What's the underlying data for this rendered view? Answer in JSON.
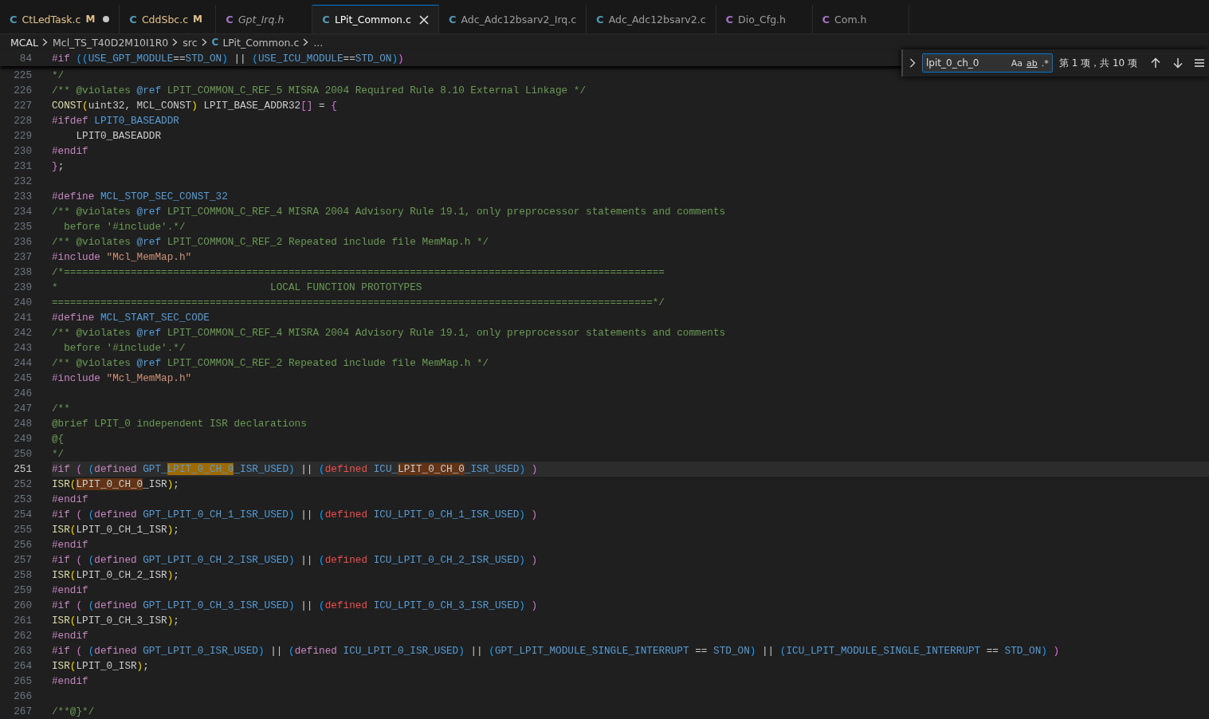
{
  "tabs": [
    {
      "icon": "C",
      "kind": "c",
      "label": "CtLedTask.c",
      "badge": "M",
      "unsaved": true,
      "preview": false,
      "selected": false
    },
    {
      "icon": "C",
      "kind": "c",
      "label": "CddSbc.c",
      "badge": "M",
      "unsaved": false,
      "preview": false,
      "selected": false
    },
    {
      "icon": "C",
      "kind": "h",
      "label": "Gpt_Irq.h",
      "unsaved": false,
      "preview": true,
      "selected": false
    },
    {
      "icon": "C",
      "kind": "c",
      "label": "LPit_Common.c",
      "unsaved": false,
      "preview": false,
      "selected": true
    },
    {
      "icon": "C",
      "kind": "c",
      "label": "Adc_Adc12bsarv2_Irq.c",
      "unsaved": false,
      "preview": false,
      "selected": false
    },
    {
      "icon": "C",
      "kind": "c",
      "label": "Adc_Adc12bsarv2.c",
      "unsaved": false,
      "preview": false,
      "selected": false
    },
    {
      "icon": "C",
      "kind": "h",
      "label": "Dio_Cfg.h",
      "unsaved": false,
      "preview": false,
      "selected": false
    },
    {
      "icon": "C",
      "kind": "h",
      "label": "Com.h",
      "unsaved": false,
      "preview": false,
      "selected": false
    }
  ],
  "breadcrumb": {
    "items": [
      "MCAL",
      "Mcl_TS_T40D2M10I1R0",
      "src"
    ],
    "file_icon": "C",
    "file": "LPit_Common.c",
    "more": "..."
  },
  "sticky_line": {
    "number": "84",
    "tokens": [
      {
        "text": "#if ",
        "kind": "kw"
      },
      {
        "text": "((",
        "kind": "b3"
      },
      {
        "text": "USE_GPT_MODULE",
        "kind": "id"
      },
      {
        "text": "==",
        "kind": "p"
      },
      {
        "text": "STD_ON",
        "kind": "id"
      },
      {
        "text": ")",
        "kind": "b3"
      },
      {
        "text": " || ",
        "kind": "p"
      },
      {
        "text": "(",
        "kind": "b3"
      },
      {
        "text": "USE_ICU_MODULE",
        "kind": "id"
      },
      {
        "text": "==",
        "kind": "p"
      },
      {
        "text": "STD_ON",
        "kind": "id"
      },
      {
        "text": ")",
        "kind": "b3"
      },
      {
        "text": ")",
        "kind": "b2"
      }
    ]
  },
  "find": {
    "value": "lpit_0_ch_0",
    "options": [
      "Aa",
      "ab",
      ".*"
    ],
    "result": "第 1 项，共 10 项"
  },
  "lines": [
    {
      "number": "225",
      "current": false,
      "tokens": [
        {
          "text": "*/",
          "kind": "cm"
        }
      ]
    },
    {
      "number": "226",
      "current": false,
      "tokens": [
        {
          "text": "/** @violates ",
          "kind": "cm"
        },
        {
          "text": "@ref",
          "kind": "ref"
        },
        {
          "text": " LPIT_COMMON_C_REF_5 MISRA 2004 Required Rule 8.10 External Linkage */",
          "kind": "cm"
        }
      ]
    },
    {
      "number": "227",
      "current": false,
      "tokens": [
        {
          "text": "CONST",
          "kind": "fn"
        },
        {
          "text": "(",
          "kind": "b1"
        },
        {
          "text": "uint32, MCL_CONST",
          "kind": "p"
        },
        {
          "text": ")",
          "kind": "b1"
        },
        {
          "text": " LPIT_BASE_ADDR32",
          "kind": "p"
        },
        {
          "text": "[]",
          "kind": "b2"
        },
        {
          "text": " = ",
          "kind": "p"
        },
        {
          "text": "{",
          "kind": "b2"
        }
      ]
    },
    {
      "number": "228",
      "current": false,
      "tokens": [
        {
          "text": "#ifdef ",
          "kind": "kw"
        },
        {
          "text": "LPIT0_BASEADDR",
          "kind": "id"
        }
      ]
    },
    {
      "number": "229",
      "current": false,
      "tokens": [
        {
          "text": "    LPIT0_BASEADDR",
          "kind": "p"
        }
      ]
    },
    {
      "number": "230",
      "current": false,
      "tokens": [
        {
          "text": "#endif",
          "kind": "kw"
        }
      ]
    },
    {
      "number": "231",
      "current": false,
      "tokens": [
        {
          "text": "}",
          "kind": "b2"
        },
        {
          "text": ";",
          "kind": "p"
        }
      ]
    },
    {
      "number": "232",
      "current": false
    },
    {
      "number": "233",
      "current": false,
      "tokens": [
        {
          "text": "#define ",
          "kind": "kw"
        },
        {
          "text": "MCL_STOP_SEC_CONST_32",
          "kind": "id"
        }
      ]
    },
    {
      "number": "234",
      "current": false,
      "tokens": [
        {
          "text": "/** @violates ",
          "kind": "cm"
        },
        {
          "text": "@ref",
          "kind": "ref"
        },
        {
          "text": " LPIT_COMMON_C_REF_4 MISRA 2004 Advisory Rule 19.1, only preprocessor statements and comments",
          "kind": "cm"
        }
      ]
    },
    {
      "number": "235",
      "current": false,
      "tokens": [
        {
          "text": "  before '#include'.*/",
          "kind": "cm"
        }
      ]
    },
    {
      "number": "236",
      "current": false,
      "tokens": [
        {
          "text": "/** @violates ",
          "kind": "cm"
        },
        {
          "text": "@ref",
          "kind": "ref"
        },
        {
          "text": " LPIT_COMMON_C_REF_2 Repeated include file MemMap.h */",
          "kind": "cm"
        }
      ]
    },
    {
      "number": "237",
      "current": false,
      "tokens": [
        {
          "text": "#include ",
          "kind": "kw"
        },
        {
          "text": "\"Mcl_MemMap.h\"",
          "kind": "str"
        }
      ]
    },
    {
      "number": "238",
      "current": false,
      "tokens": [
        {
          "text": "/*===================================================================================================",
          "kind": "cm"
        }
      ]
    },
    {
      "number": "239",
      "current": false,
      "tokens": [
        {
          "text": "*                                   LOCAL FUNCTION PROTOTYPES",
          "kind": "cm"
        }
      ]
    },
    {
      "number": "240",
      "current": false,
      "tokens": [
        {
          "text": "===================================================================================================*/",
          "kind": "cm"
        }
      ]
    },
    {
      "number": "241",
      "current": false,
      "tokens": [
        {
          "text": "#define ",
          "kind": "kw"
        },
        {
          "text": "MCL_START_SEC_CODE",
          "kind": "id"
        }
      ]
    },
    {
      "number": "242",
      "current": false,
      "tokens": [
        {
          "text": "/** @violates ",
          "kind": "cm"
        },
        {
          "text": "@ref",
          "kind": "ref"
        },
        {
          "text": " LPIT_COMMON_C_REF_4 MISRA 2004 Advisory Rule 19.1, only preprocessor statements and comments",
          "kind": "cm"
        }
      ]
    },
    {
      "number": "243",
      "current": false,
      "tokens": [
        {
          "text": "  before '#include'.*/",
          "kind": "cm"
        }
      ]
    },
    {
      "number": "244",
      "current": false,
      "tokens": [
        {
          "text": "/** @violates ",
          "kind": "cm"
        },
        {
          "text": "@ref",
          "kind": "ref"
        },
        {
          "text": " LPIT_COMMON_C_REF_2 Repeated include file MemMap.h */",
          "kind": "cm"
        }
      ]
    },
    {
      "number": "245",
      "current": false,
      "tokens": [
        {
          "text": "#include ",
          "kind": "kw"
        },
        {
          "text": "\"Mcl_MemMap.h\"",
          "kind": "str"
        }
      ]
    },
    {
      "number": "246",
      "current": false
    },
    {
      "number": "247",
      "current": false,
      "tokens": [
        {
          "text": "/**",
          "kind": "cm"
        }
      ]
    },
    {
      "number": "248",
      "current": false,
      "tokens": [
        {
          "text": "@brief LPIT_0 independent ISR declarations",
          "kind": "cm"
        }
      ]
    },
    {
      "number": "249",
      "current": false,
      "tokens": [
        {
          "text": "@{",
          "kind": "cm"
        }
      ]
    },
    {
      "number": "250",
      "current": false,
      "tokens": [
        {
          "text": "*/",
          "kind": "cm"
        }
      ]
    },
    {
      "number": "251",
      "current": true,
      "tokens": [
        {
          "text": "#if ",
          "kind": "kw"
        },
        {
          "text": "( ",
          "kind": "b2"
        },
        {
          "text": "(",
          "kind": "b3"
        },
        {
          "text": "defined ",
          "kind": "kw"
        },
        {
          "text": "GPT_",
          "kind": "id"
        },
        {
          "text": "LPIT_0_CH_0",
          "kind": "hl"
        },
        {
          "text": "_ISR_USED",
          "kind": "id"
        },
        {
          "text": ")",
          "kind": "b3"
        },
        {
          "text": " || ",
          "kind": "p"
        },
        {
          "text": "(",
          "kind": "b3"
        },
        {
          "text": "defined ",
          "kind": "err"
        },
        {
          "text": "ICU_",
          "kind": "id"
        },
        {
          "text": "LPIT_0_CH_0",
          "kind": "hl2"
        },
        {
          "text": "_ISR_USED",
          "kind": "id"
        },
        {
          "text": ")",
          "kind": "b3"
        },
        {
          "text": " )",
          "kind": "b2"
        }
      ]
    },
    {
      "number": "252",
      "current": false,
      "tokens": [
        {
          "text": "ISR",
          "kind": "fn"
        },
        {
          "text": "(",
          "kind": "b1"
        },
        {
          "text": "LPIT_0_CH_0",
          "kind": "hl2"
        },
        {
          "text": "_ISR",
          "kind": "p"
        },
        {
          "text": ")",
          "kind": "b1"
        },
        {
          "text": ";",
          "kind": "p"
        }
      ]
    },
    {
      "number": "253",
      "current": false,
      "tokens": [
        {
          "text": "#endif",
          "kind": "kw"
        }
      ]
    },
    {
      "number": "254",
      "current": false,
      "tokens": [
        {
          "text": "#if ",
          "kind": "kw"
        },
        {
          "text": "( ",
          "kind": "b2"
        },
        {
          "text": "(",
          "kind": "b3"
        },
        {
          "text": "defined ",
          "kind": "kw"
        },
        {
          "text": "GPT_LPIT_0_CH_1_ISR_USED",
          "kind": "id"
        },
        {
          "text": ")",
          "kind": "b3"
        },
        {
          "text": " || ",
          "kind": "p"
        },
        {
          "text": "(",
          "kind": "b3"
        },
        {
          "text": "defined ",
          "kind": "err"
        },
        {
          "text": "ICU_LPIT_0_CH_1_ISR_USED",
          "kind": "id"
        },
        {
          "text": ")",
          "kind": "b3"
        },
        {
          "text": " )",
          "kind": "b2"
        }
      ]
    },
    {
      "number": "255",
      "current": false,
      "tokens": [
        {
          "text": "ISR",
          "kind": "fn"
        },
        {
          "text": "(",
          "kind": "b1"
        },
        {
          "text": "LPIT_0_CH_1_ISR",
          "kind": "p"
        },
        {
          "text": ")",
          "kind": "b1"
        },
        {
          "text": ";",
          "kind": "p"
        }
      ]
    },
    {
      "number": "256",
      "current": false,
      "tokens": [
        {
          "text": "#endif",
          "kind": "kw"
        }
      ]
    },
    {
      "number": "257",
      "current": false,
      "tokens": [
        {
          "text": "#if ",
          "kind": "kw"
        },
        {
          "text": "( ",
          "kind": "b2"
        },
        {
          "text": "(",
          "kind": "b3"
        },
        {
          "text": "defined ",
          "kind": "kw"
        },
        {
          "text": "GPT_LPIT_0_CH_2_ISR_USED",
          "kind": "id"
        },
        {
          "text": ")",
          "kind": "b3"
        },
        {
          "text": " || ",
          "kind": "p"
        },
        {
          "text": "(",
          "kind": "b3"
        },
        {
          "text": "defined ",
          "kind": "err"
        },
        {
          "text": "ICU_LPIT_0_CH_2_ISR_USED",
          "kind": "id"
        },
        {
          "text": ")",
          "kind": "b3"
        },
        {
          "text": " )",
          "kind": "b2"
        }
      ]
    },
    {
      "number": "258",
      "current": false,
      "tokens": [
        {
          "text": "ISR",
          "kind": "fn"
        },
        {
          "text": "(",
          "kind": "b1"
        },
        {
          "text": "LPIT_0_CH_2_ISR",
          "kind": "p"
        },
        {
          "text": ")",
          "kind": "b1"
        },
        {
          "text": ";",
          "kind": "p"
        }
      ]
    },
    {
      "number": "259",
      "current": false,
      "tokens": [
        {
          "text": "#endif",
          "kind": "kw"
        }
      ]
    },
    {
      "number": "260",
      "current": false,
      "tokens": [
        {
          "text": "#if ",
          "kind": "kw"
        },
        {
          "text": "( ",
          "kind": "b2"
        },
        {
          "text": "(",
          "kind": "b3"
        },
        {
          "text": "defined ",
          "kind": "kw"
        },
        {
          "text": "GPT_LPIT_0_CH_3_ISR_USED",
          "kind": "id"
        },
        {
          "text": ")",
          "kind": "b3"
        },
        {
          "text": " || ",
          "kind": "p"
        },
        {
          "text": "(",
          "kind": "b3"
        },
        {
          "text": "defined ",
          "kind": "err"
        },
        {
          "text": "ICU_LPIT_0_CH_3_ISR_USED",
          "kind": "id"
        },
        {
          "text": ")",
          "kind": "b3"
        },
        {
          "text": " )",
          "kind": "b2"
        }
      ]
    },
    {
      "number": "261",
      "current": false,
      "tokens": [
        {
          "text": "ISR",
          "kind": "fn"
        },
        {
          "text": "(",
          "kind": "b1"
        },
        {
          "text": "LPIT_0_CH_3_ISR",
          "kind": "p"
        },
        {
          "text": ")",
          "kind": "b1"
        },
        {
          "text": ";",
          "kind": "p"
        }
      ]
    },
    {
      "number": "262",
      "current": false,
      "tokens": [
        {
          "text": "#endif",
          "kind": "kw"
        }
      ]
    },
    {
      "number": "263",
      "current": false,
      "tokens": [
        {
          "text": "#if ",
          "kind": "kw"
        },
        {
          "text": "( ",
          "kind": "b2"
        },
        {
          "text": "(",
          "kind": "b3"
        },
        {
          "text": "defined ",
          "kind": "kw"
        },
        {
          "text": "GPT_LPIT_0_ISR_USED",
          "kind": "id"
        },
        {
          "text": ")",
          "kind": "b3"
        },
        {
          "text": " || ",
          "kind": "p"
        },
        {
          "text": "(",
          "kind": "b3"
        },
        {
          "text": "defined ",
          "kind": "kw"
        },
        {
          "text": "ICU_LPIT_0_ISR_USED",
          "kind": "id"
        },
        {
          "text": ")",
          "kind": "b3"
        },
        {
          "text": " || ",
          "kind": "p"
        },
        {
          "text": "(",
          "kind": "b3"
        },
        {
          "text": "GPT_LPIT_MODULE_SINGLE_INTERRUPT",
          "kind": "id"
        },
        {
          "text": " == ",
          "kind": "p"
        },
        {
          "text": "STD_ON",
          "kind": "id"
        },
        {
          "text": ")",
          "kind": "b3"
        },
        {
          "text": " || ",
          "kind": "p"
        },
        {
          "text": "(",
          "kind": "b3"
        },
        {
          "text": "ICU_LPIT_MODULE_SINGLE_INTERRUPT",
          "kind": "id"
        },
        {
          "text": " == ",
          "kind": "p"
        },
        {
          "text": "STD_ON",
          "kind": "id"
        },
        {
          "text": ")",
          "kind": "b3"
        },
        {
          "text": " )",
          "kind": "b2"
        }
      ]
    },
    {
      "number": "264",
      "current": false,
      "tokens": [
        {
          "text": "ISR",
          "kind": "fn"
        },
        {
          "text": "(",
          "kind": "b1"
        },
        {
          "text": "LPIT_0_ISR",
          "kind": "p"
        },
        {
          "text": ")",
          "kind": "b1"
        },
        {
          "text": ";",
          "kind": "p"
        }
      ]
    },
    {
      "number": "265",
      "current": false,
      "tokens": [
        {
          "text": "#endif",
          "kind": "kw"
        }
      ]
    },
    {
      "number": "266",
      "current": false
    },
    {
      "number": "267",
      "current": false,
      "tokens": [
        {
          "text": "/**@}*/",
          "kind": "cm"
        }
      ]
    }
  ]
}
